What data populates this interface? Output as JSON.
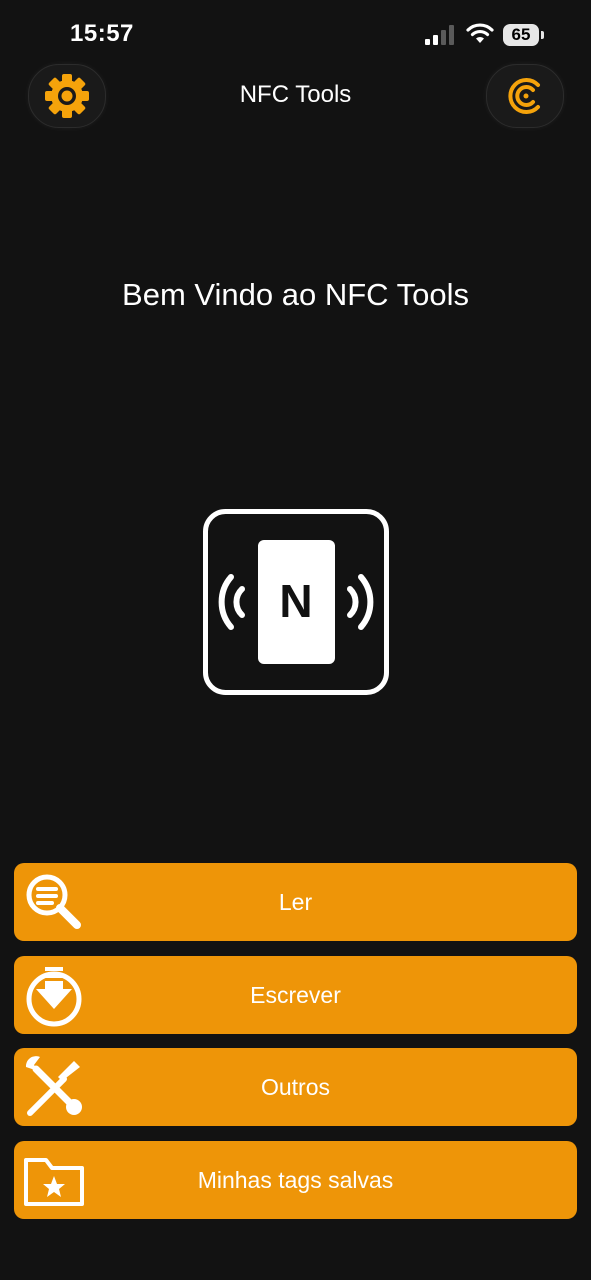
{
  "status_bar": {
    "time": "15:57",
    "battery": "65"
  },
  "header": {
    "title": "NFC Tools",
    "settings_icon": "gear-icon",
    "pro_icon": "pro-c-icon"
  },
  "main": {
    "welcome": "Bem Vindo ao NFC Tools",
    "logo_letter": "N"
  },
  "actions": [
    {
      "label": "Ler",
      "icon": "magnifier-icon"
    },
    {
      "label": "Escrever",
      "icon": "download-circle-icon"
    },
    {
      "label": "Outros",
      "icon": "tools-icon"
    },
    {
      "label": "Minhas tags salvas",
      "icon": "folder-star-icon"
    }
  ],
  "colors": {
    "background": "#121212",
    "accent": "#ee9508",
    "text": "#ffffff"
  }
}
